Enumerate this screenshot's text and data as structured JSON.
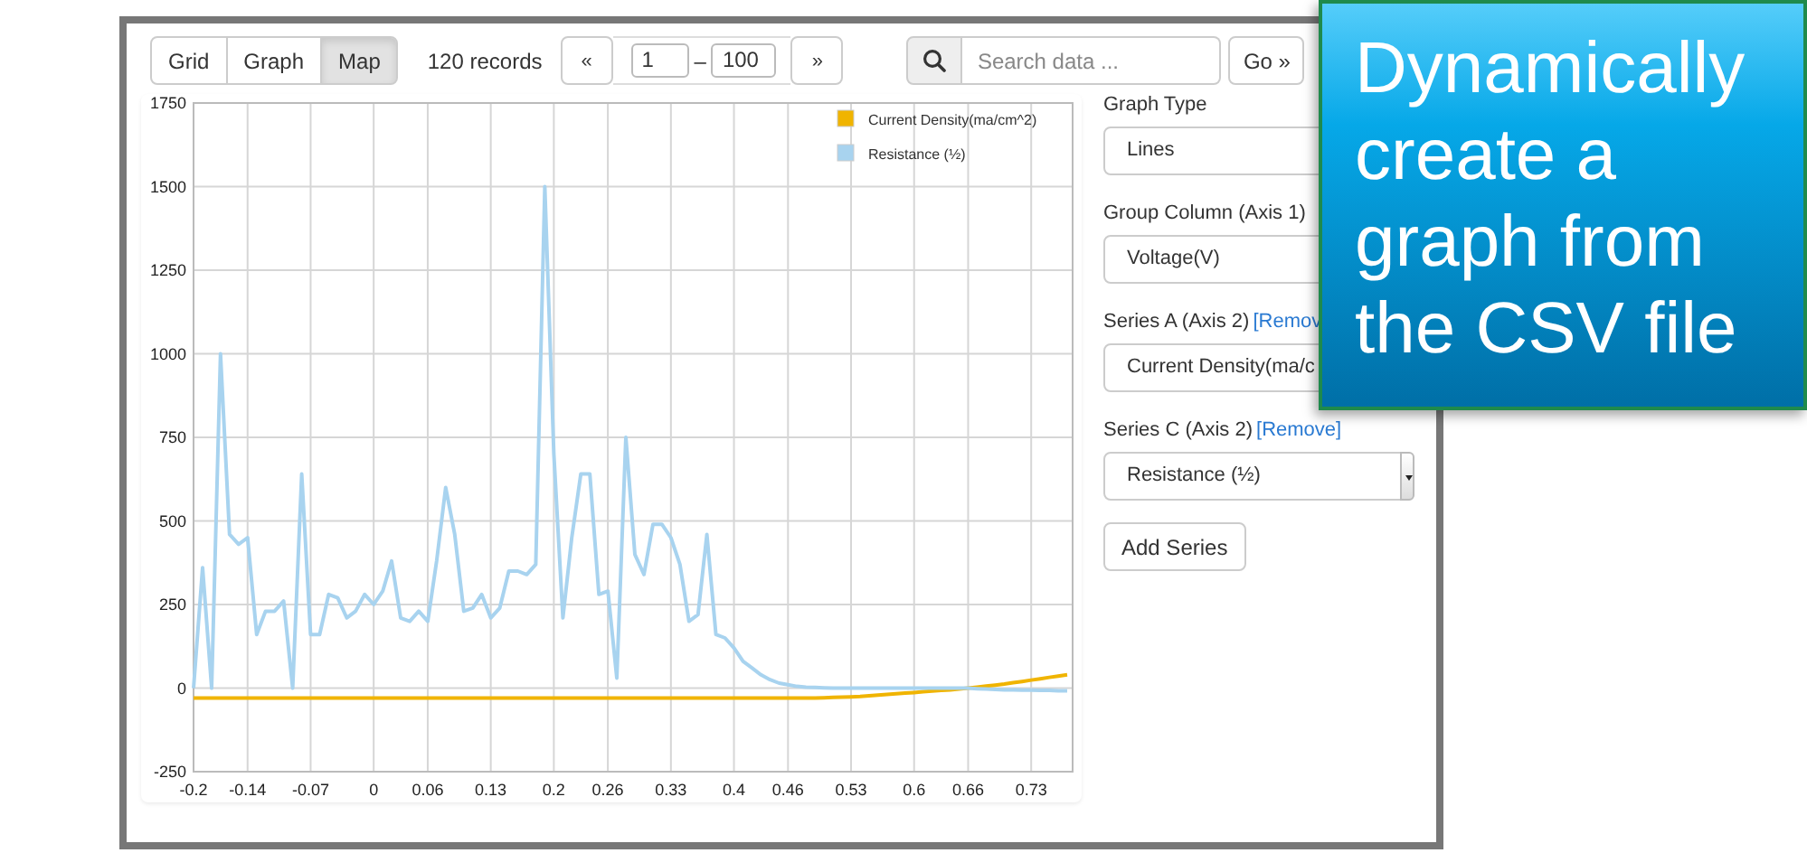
{
  "toolbar": {
    "view_tabs": [
      {
        "label": "Grid",
        "selected": false
      },
      {
        "label": "Graph",
        "selected": false
      },
      {
        "label": "Map",
        "selected": true
      }
    ],
    "record_count": "120 records",
    "pager": {
      "first": "«",
      "from": "1",
      "separator": "–",
      "to": "100",
      "next": "»"
    },
    "search": {
      "placeholder": "Search data ...",
      "button": "Go »"
    }
  },
  "chart": {
    "chart_data": {
      "type": "line",
      "x": [
        -0.2,
        -0.19,
        -0.18,
        -0.17,
        -0.16,
        -0.15,
        -0.14,
        -0.13,
        -0.12,
        -0.11,
        -0.1,
        -0.09,
        -0.08,
        -0.07,
        -0.06,
        -0.05,
        -0.04,
        -0.03,
        -0.02,
        -0.01,
        0,
        0.01,
        0.02,
        0.03,
        0.04,
        0.05,
        0.06,
        0.07,
        0.08,
        0.09,
        0.1,
        0.11,
        0.12,
        0.13,
        0.14,
        0.15,
        0.16,
        0.17,
        0.18,
        0.19,
        0.2,
        0.21,
        0.22,
        0.23,
        0.24,
        0.25,
        0.26,
        0.27,
        0.28,
        0.29,
        0.3,
        0.31,
        0.32,
        0.33,
        0.34,
        0.35,
        0.36,
        0.37,
        0.38,
        0.39,
        0.4,
        0.41,
        0.42,
        0.43,
        0.44,
        0.45,
        0.46,
        0.47,
        0.48,
        0.49,
        0.5,
        0.51,
        0.52,
        0.53,
        0.54,
        0.55,
        0.56,
        0.57,
        0.58,
        0.59,
        0.6,
        0.61,
        0.62,
        0.63,
        0.64,
        0.65,
        0.66,
        0.67,
        0.68,
        0.69,
        0.7,
        0.71,
        0.72,
        0.73,
        0.74,
        0.75,
        0.76,
        0.77
      ],
      "series": [
        {
          "name": "Current Density(ma/cm^2)",
          "color": "#f0b400",
          "values": [
            -30,
            -30,
            -30,
            -30,
            -30,
            -30,
            -30,
            -30,
            -30,
            -30,
            -30,
            -30,
            -30,
            -30,
            -30,
            -30,
            -30,
            -30,
            -30,
            -30,
            -30,
            -30,
            -30,
            -30,
            -30,
            -30,
            -30,
            -30,
            -30,
            -30,
            -30,
            -30,
            -30,
            -30,
            -30,
            -30,
            -30,
            -30,
            -30,
            -30,
            -30,
            -30,
            -30,
            -30,
            -30,
            -30,
            -30,
            -30,
            -30,
            -30,
            -30,
            -30,
            -30,
            -30,
            -30,
            -30,
            -30,
            -30,
            -30,
            -30,
            -30,
            -30,
            -30,
            -30,
            -30,
            -30,
            -30,
            -30,
            -30,
            -30,
            -29,
            -28,
            -27,
            -26,
            -25,
            -23,
            -21,
            -19,
            -17,
            -15,
            -13,
            -11,
            -9,
            -7,
            -5,
            -3,
            0,
            3,
            6,
            9,
            12,
            16,
            20,
            24,
            28,
            32,
            36,
            40
          ]
        },
        {
          "name": "Resistance (½)",
          "color": "#a8d3ef",
          "values": [
            0,
            360,
            0,
            1000,
            460,
            430,
            450,
            160,
            230,
            230,
            260,
            0,
            640,
            160,
            160,
            280,
            270,
            210,
            230,
            280,
            250,
            290,
            380,
            210,
            200,
            230,
            200,
            380,
            600,
            460,
            230,
            240,
            280,
            210,
            240,
            350,
            350,
            340,
            370,
            1500,
            700,
            210,
            450,
            640,
            640,
            280,
            290,
            30,
            750,
            400,
            340,
            490,
            490,
            450,
            370,
            200,
            220,
            460,
            160,
            150,
            120,
            80,
            60,
            40,
            25,
            15,
            10,
            5,
            3,
            2,
            1,
            0,
            0,
            0,
            0,
            0,
            0,
            0,
            0,
            0,
            0,
            0,
            0,
            0,
            0,
            0,
            0,
            -2,
            -3,
            -4,
            -5,
            -5,
            -6,
            -6,
            -7,
            -7,
            -8,
            -8
          ]
        }
      ],
      "xlim": [
        -0.2,
        0.776
      ],
      "ylim": [
        -250,
        1750
      ],
      "xticks": [
        {
          "value": -0.2,
          "label": "-0.2"
        },
        {
          "value": -0.14,
          "label": "-0.14"
        },
        {
          "value": -0.07,
          "label": "-0.07"
        },
        {
          "value": 0,
          "label": "0"
        },
        {
          "value": 0.06,
          "label": "0.06"
        },
        {
          "value": 0.13,
          "label": "0.13"
        },
        {
          "value": 0.2,
          "label": "0.2"
        },
        {
          "value": 0.26,
          "label": "0.26"
        },
        {
          "value": 0.33,
          "label": "0.33"
        },
        {
          "value": 0.4,
          "label": "0.4"
        },
        {
          "value": 0.46,
          "label": "0.46"
        },
        {
          "value": 0.53,
          "label": "0.53"
        },
        {
          "value": 0.6,
          "label": "0.6"
        },
        {
          "value": 0.66,
          "label": "0.66"
        },
        {
          "value": 0.73,
          "label": "0.73"
        }
      ],
      "yticks": [
        -250,
        0,
        250,
        500,
        750,
        1000,
        1250,
        1500,
        1750
      ],
      "grid": true,
      "legend": true
    }
  },
  "settings": {
    "fields": [
      {
        "label": "Graph Type",
        "value": "Lines"
      },
      {
        "label": "Group Column (Axis 1)",
        "value": "Voltage(V)"
      },
      {
        "label": "Series A (Axis 2)",
        "remove_link": "[Remov",
        "value": "Current Density(ma/c"
      },
      {
        "label": "Series C (Axis 2)",
        "remove_link": "[Remove]",
        "value": "Resistance (½)",
        "caret": true
      }
    ],
    "add_button": "Add Series"
  },
  "callout": {
    "text": "Dynamically create a graph from the CSV file"
  }
}
